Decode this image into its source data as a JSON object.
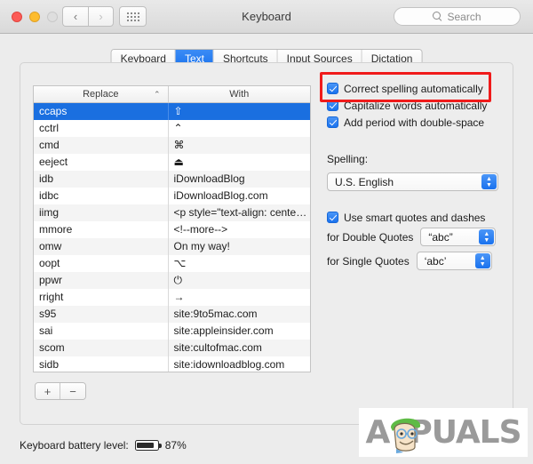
{
  "window": {
    "title": "Keyboard",
    "traffic_lights": [
      "close",
      "minimize",
      "maximize"
    ],
    "nav_back": "‹",
    "nav_forward": "›"
  },
  "search": {
    "placeholder": "Search",
    "value": "Search",
    "icon": "search-icon"
  },
  "tabs": [
    {
      "label": "Keyboard",
      "active": false
    },
    {
      "label": "Text",
      "active": true
    },
    {
      "label": "Shortcuts",
      "active": false
    },
    {
      "label": "Input Sources",
      "active": false
    },
    {
      "label": "Dictation",
      "active": false
    }
  ],
  "table": {
    "columns": [
      "Replace",
      "With"
    ],
    "sort_indicator": "⌃",
    "rows": [
      {
        "replace": "ccaps",
        "with": "⇧",
        "selected": true
      },
      {
        "replace": "cctrl",
        "with": "⌃",
        "selected": false
      },
      {
        "replace": "cmd",
        "with": "⌘",
        "selected": false
      },
      {
        "replace": "eeject",
        "with": "⏏",
        "selected": false
      },
      {
        "replace": "idb",
        "with": "iDownloadBlog",
        "selected": false
      },
      {
        "replace": "idbc",
        "with": "iDownloadBlog.com",
        "selected": false
      },
      {
        "replace": "iimg",
        "with": "<p style=\"text-align: cente…",
        "selected": false
      },
      {
        "replace": "mmore",
        "with": "<!--more-->",
        "selected": false
      },
      {
        "replace": "omw",
        "with": "On my way!",
        "selected": false
      },
      {
        "replace": "oopt",
        "with": "⌥",
        "selected": false
      },
      {
        "replace": "ppwr",
        "with": "⏻",
        "selected": false
      },
      {
        "replace": "rright",
        "with": "→",
        "selected": false
      },
      {
        "replace": "s95",
        "with": "site:9to5mac.com",
        "selected": false
      },
      {
        "replace": "sai",
        "with": "site:appleinsider.com",
        "selected": false
      },
      {
        "replace": "scom",
        "with": "site:cultofmac.com",
        "selected": false
      },
      {
        "replace": "sidb",
        "with": "site:idownloadblog.com",
        "selected": false
      }
    ],
    "add_button": "+",
    "remove_button": "−"
  },
  "options": {
    "checkboxes": [
      {
        "label": "Correct spelling automatically",
        "checked": true,
        "highlighted": true
      },
      {
        "label": "Capitalize words automatically",
        "checked": true,
        "highlighted": false
      },
      {
        "label": "Add period with double-space",
        "checked": true,
        "highlighted": false
      }
    ],
    "spelling_label": "Spelling:",
    "spelling_value": "U.S. English",
    "smart_quotes_label": "Use smart quotes and dashes",
    "smart_quotes_checked": true,
    "double_quotes_label": "for Double Quotes",
    "double_quotes_value": "“abc”",
    "single_quotes_label": "for Single Quotes",
    "single_quotes_value": "‘abc’",
    "popup_arrow_up": "▲",
    "popup_arrow_down": "▼"
  },
  "annotation": {
    "color": "#f01b1b",
    "target": "Correct spelling automatically"
  },
  "footer": {
    "battery_label": "Keyboard battery level:",
    "battery_percent": "87%",
    "battery_fill_pct": 87
  },
  "watermark": {
    "text": "APPUALS",
    "prefix": "A",
    "suffix": "PUALS"
  }
}
